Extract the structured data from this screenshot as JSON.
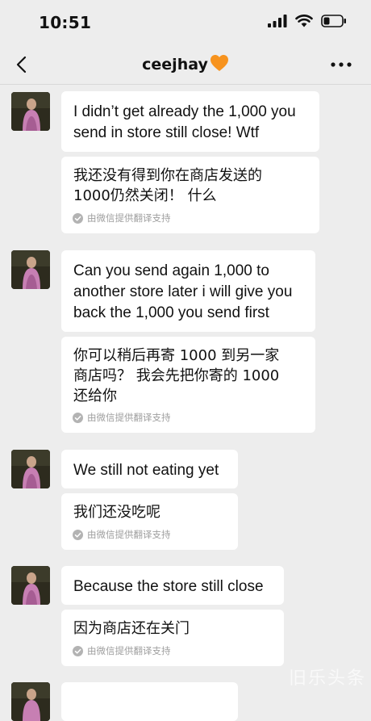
{
  "status_bar": {
    "time": "10:51"
  },
  "header": {
    "title": "ceejhay",
    "title_emoji": "orange-heart-icon",
    "back_icon": "chevron-left-icon",
    "more_icon": "more-dots-icon"
  },
  "messages": [
    {
      "text": "I didn’t get already the 1,000 you\n send in store still close! Wtf",
      "translation": "我还没有得到你在商店发送的\n1000仍然关闭！ 什么",
      "translation_note": "由微信提供翻译支持"
    },
    {
      "text": "Can you send again 1,000 to\nanother store later i will give you\n back the 1,000 you send first",
      "translation": "你可以稍后再寄 1000 到另一家\n商店吗？ 我会先把你寄的 1000\n还给你",
      "translation_note": "由微信提供翻译支持"
    },
    {
      "text": "We still not eating yet",
      "translation": "我们还没吃呢",
      "translation_note": "由微信提供翻译支持"
    },
    {
      "text": "Because the store still close",
      "translation": "因为商店还在关门",
      "translation_note": "由微信提供翻译支持"
    }
  ],
  "watermark": "旧乐头条",
  "colors": {
    "background": "#ededed",
    "bubble": "#ffffff",
    "heart": "#f7931e",
    "note_text": "#9e9e9e"
  }
}
